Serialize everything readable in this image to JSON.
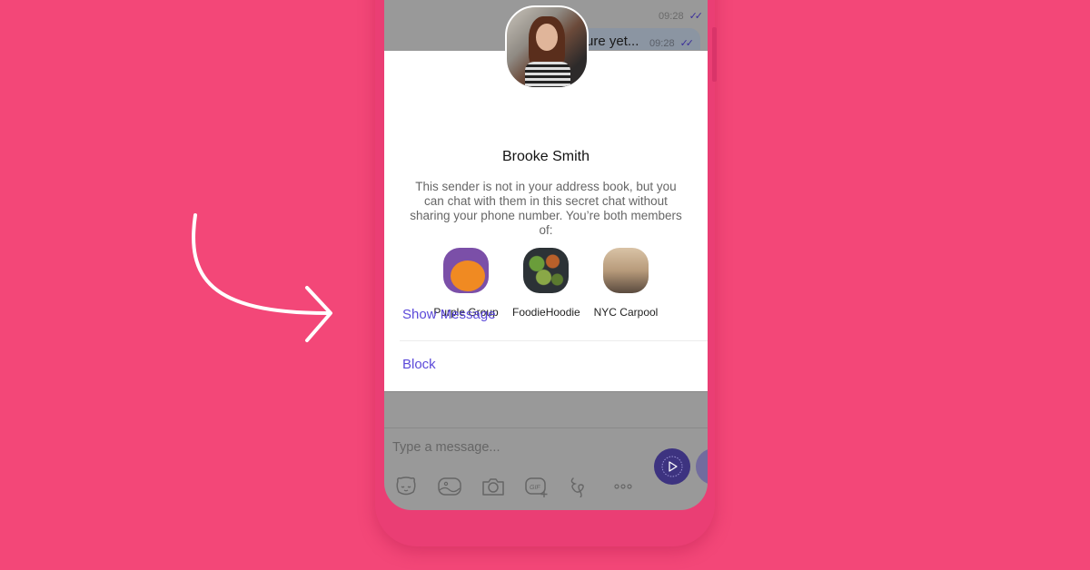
{
  "chat": {
    "messages": [
      {
        "time": "09:28",
        "status_icon": "double-check-icon"
      },
      {
        "text": "ure yet...",
        "time": "09:28",
        "status_icon": "double-check-icon"
      }
    ]
  },
  "dialog": {
    "sender_name": "Brooke Smith",
    "description": "This sender is not in your address book, but you can chat with them in this secret chat without sharing your phone number. You’re both members of:",
    "groups": [
      {
        "label": "Purple Group",
        "icon": "purple-group-avatar"
      },
      {
        "label": "FoodieHoodie",
        "icon": "foodiehoodie-avatar"
      },
      {
        "label": "NYC Carpool",
        "icon": "nyc-carpool-avatar"
      }
    ],
    "actions": {
      "show_message": "Show Message",
      "block": "Block"
    }
  },
  "composer": {
    "placeholder": "Type a message...",
    "tools": [
      "sticker-icon",
      "gallery-icon",
      "camera-icon",
      "gif-icon",
      "doodle-icon",
      "more-icon"
    ]
  },
  "colors": {
    "background": "#f34778",
    "accent": "#5b49d9",
    "send_button": "#3d3380"
  }
}
